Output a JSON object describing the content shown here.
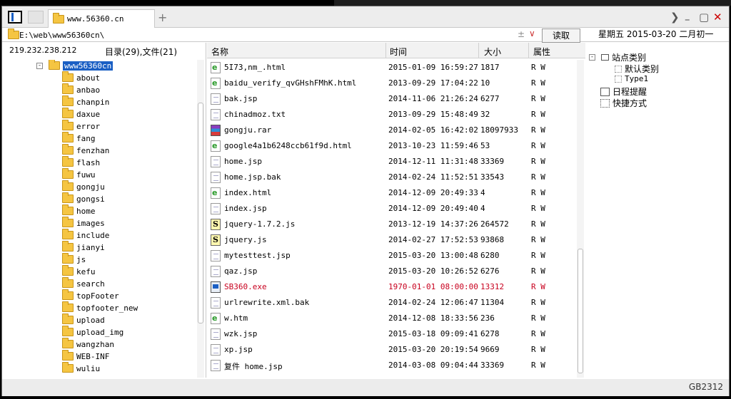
{
  "tabs": [
    {
      "label": "www.56360.cn"
    }
  ],
  "address": {
    "path": "E:\\web\\www56360cn\\",
    "plus_minus": "±",
    "dropdown": "∨"
  },
  "read_button": "读取",
  "date": "星期五  2015-03-20  二月初一",
  "left": {
    "ip": "219.232.238.212",
    "dircount": "目录(29),文件(21)",
    "root": "www56360cn",
    "folders": [
      "about",
      "anbao",
      "chanpin",
      "daxue",
      "error",
      "fang",
      "fenzhan",
      "flash",
      "fuwu",
      "gongju",
      "gongsi",
      "home",
      "images",
      "include",
      "jianyi",
      "js",
      "kefu",
      "search",
      "topFooter",
      "topfooter_new",
      "upload",
      "upload_img",
      "wangzhan",
      "WEB-INF",
      "wuliu"
    ]
  },
  "columns": {
    "name": "名称",
    "time": "时间",
    "size": "大小",
    "attr": "属性"
  },
  "files": [
    {
      "icon": "html",
      "name": "5I73,nm_.html",
      "time": "2015-01-09 16:59:27",
      "size": "1817",
      "attr": "R W"
    },
    {
      "icon": "html",
      "name": "baidu_verify_qvGHshFMhK.html",
      "time": "2013-09-29 17:04:22",
      "size": "10",
      "attr": "R W"
    },
    {
      "icon": "doc",
      "name": "bak.jsp",
      "time": "2014-11-06 21:26:24",
      "size": "6277",
      "attr": "R W"
    },
    {
      "icon": "doc",
      "name": "chinadmoz.txt",
      "time": "2013-09-29 15:48:49",
      "size": "32",
      "attr": "R W"
    },
    {
      "icon": "rar",
      "name": "gongju.rar",
      "time": "2014-02-05 16:42:02",
      "size": "18097933",
      "attr": "R W"
    },
    {
      "icon": "html",
      "name": "google4a1b6248ccb61f9d.html",
      "time": "2013-10-23 11:59:46",
      "size": "53",
      "attr": "R W"
    },
    {
      "icon": "doc",
      "name": "home.jsp",
      "time": "2014-12-11 11:31:48",
      "size": "33369",
      "attr": "R W"
    },
    {
      "icon": "doc",
      "name": "home.jsp.bak",
      "time": "2014-02-24 11:52:51",
      "size": "33543",
      "attr": "R W"
    },
    {
      "icon": "html",
      "name": "index.html",
      "time": "2014-12-09 20:49:33",
      "size": "4",
      "attr": "R W"
    },
    {
      "icon": "doc",
      "name": "index.jsp",
      "time": "2014-12-09 20:49:40",
      "size": "4",
      "attr": "R W"
    },
    {
      "icon": "js",
      "name": "jquery-1.7.2.js",
      "time": "2013-12-19 14:37:26",
      "size": "264572",
      "attr": "R W"
    },
    {
      "icon": "js",
      "name": "jquery.js",
      "time": "2014-02-27 17:52:53",
      "size": "93868",
      "attr": "R W"
    },
    {
      "icon": "doc",
      "name": "mytesttest.jsp",
      "time": "2015-03-20 13:00:48",
      "size": "6280",
      "attr": "R W"
    },
    {
      "icon": "doc",
      "name": "qaz.jsp",
      "time": "2015-03-20 10:26:52",
      "size": "6276",
      "attr": "R W"
    },
    {
      "icon": "exe",
      "name": "SB360.exe",
      "time": "1970-01-01 08:00:00",
      "size": "13312",
      "attr": "R W",
      "red": true
    },
    {
      "icon": "doc",
      "name": "urlrewrite.xml.bak",
      "time": "2014-02-24 12:06:47",
      "size": "11304",
      "attr": "R W"
    },
    {
      "icon": "html",
      "name": "w.htm",
      "time": "2014-12-08 18:33:56",
      "size": "236",
      "attr": "R W"
    },
    {
      "icon": "doc",
      "name": "wzk.jsp",
      "time": "2015-03-18 09:09:41",
      "size": "6278",
      "attr": "R W"
    },
    {
      "icon": "doc",
      "name": "xp.jsp",
      "time": "2015-03-20 20:19:54",
      "size": "9669",
      "attr": "R W"
    },
    {
      "icon": "doc",
      "name": "复件 home.jsp",
      "time": "2014-03-08 09:04:44",
      "size": "33369",
      "attr": "R W"
    }
  ],
  "right": {
    "site_category": "站点类别",
    "default_category": "默认类别",
    "type1": "Type1",
    "schedule": "日程提醒",
    "shortcut": "快捷方式"
  },
  "status": {
    "encoding": "GB2312"
  },
  "colors": {
    "selection": "#1a5fc4",
    "highlight_row": "#c8001e"
  }
}
